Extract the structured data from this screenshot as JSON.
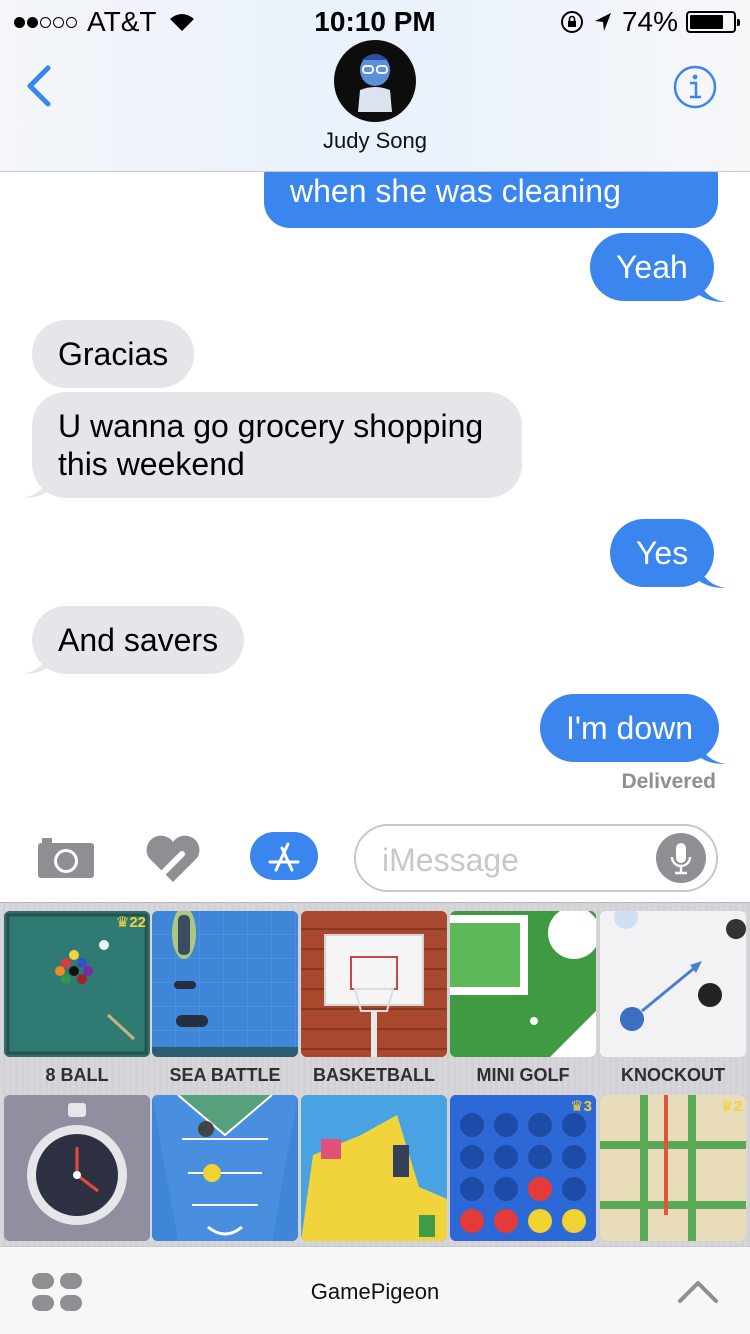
{
  "status_bar": {
    "carrier": "AT&T",
    "signal_bars_filled": 2,
    "signal_bars_total": 5,
    "time": "10:10 PM",
    "battery_percent": "74%",
    "battery_level": 0.74
  },
  "header": {
    "contact_name": "Judy Song",
    "back_icon": "chevron-left-icon",
    "info_icon": "info-icon"
  },
  "messages": [
    {
      "direction": "outgoing",
      "text": "when she was cleaning"
    },
    {
      "direction": "outgoing",
      "text": "Yeah"
    },
    {
      "direction": "incoming",
      "text": "Gracias"
    },
    {
      "direction": "incoming",
      "text": "U wanna go grocery shopping this weekend"
    },
    {
      "direction": "outgoing",
      "text": "Yes"
    },
    {
      "direction": "incoming",
      "text": "And savers"
    },
    {
      "direction": "outgoing",
      "text": "I'm down"
    }
  ],
  "delivered_label": "Delivered",
  "input_bar": {
    "placeholder": "iMessage",
    "icons": [
      "camera-icon",
      "digital-touch-icon",
      "app-store-icon",
      "microphone-icon"
    ]
  },
  "games": [
    {
      "label": "8 BALL",
      "badge": "22"
    },
    {
      "label": "SEA BATTLE"
    },
    {
      "label": "BASKETBALL"
    },
    {
      "label": "MINI GOLF"
    },
    {
      "label": "KNOCKOUT"
    },
    {
      "label": ""
    },
    {
      "label": ""
    },
    {
      "label": ""
    },
    {
      "label": "",
      "badge": "3"
    },
    {
      "label": "",
      "badge": "2"
    }
  ],
  "bottom_bar": {
    "title": "GamePigeon",
    "apps_icon": "app-drawer-icon",
    "expand_icon": "chevron-up-icon"
  },
  "colors": {
    "outgoing_bubble": "#3a86ee",
    "incoming_bubble": "#e6e6ea",
    "accent": "#3a86ee"
  }
}
